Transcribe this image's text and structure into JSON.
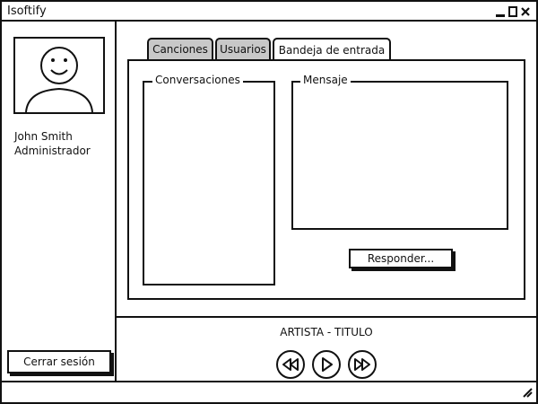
{
  "window": {
    "title": "Isoftify",
    "controls": [
      "minimize-icon",
      "maximize-icon",
      "close-icon"
    ]
  },
  "sidebar": {
    "user_name": "John Smith",
    "user_role": "Administrador",
    "logout_label": "Cerrar sesión"
  },
  "tabs": [
    {
      "label": "Canciones",
      "active": false
    },
    {
      "label": "Usuarios",
      "active": false
    },
    {
      "label": "Bandeja de entrada",
      "active": true
    }
  ],
  "inbox": {
    "conversations_label": "Conversaciones",
    "message_label": "Mensaje",
    "respond_label": "Responder..."
  },
  "player": {
    "track": "ARTISTA - TITULO",
    "controls": [
      "rewind-icon",
      "play-icon",
      "fast-forward-icon"
    ]
  }
}
